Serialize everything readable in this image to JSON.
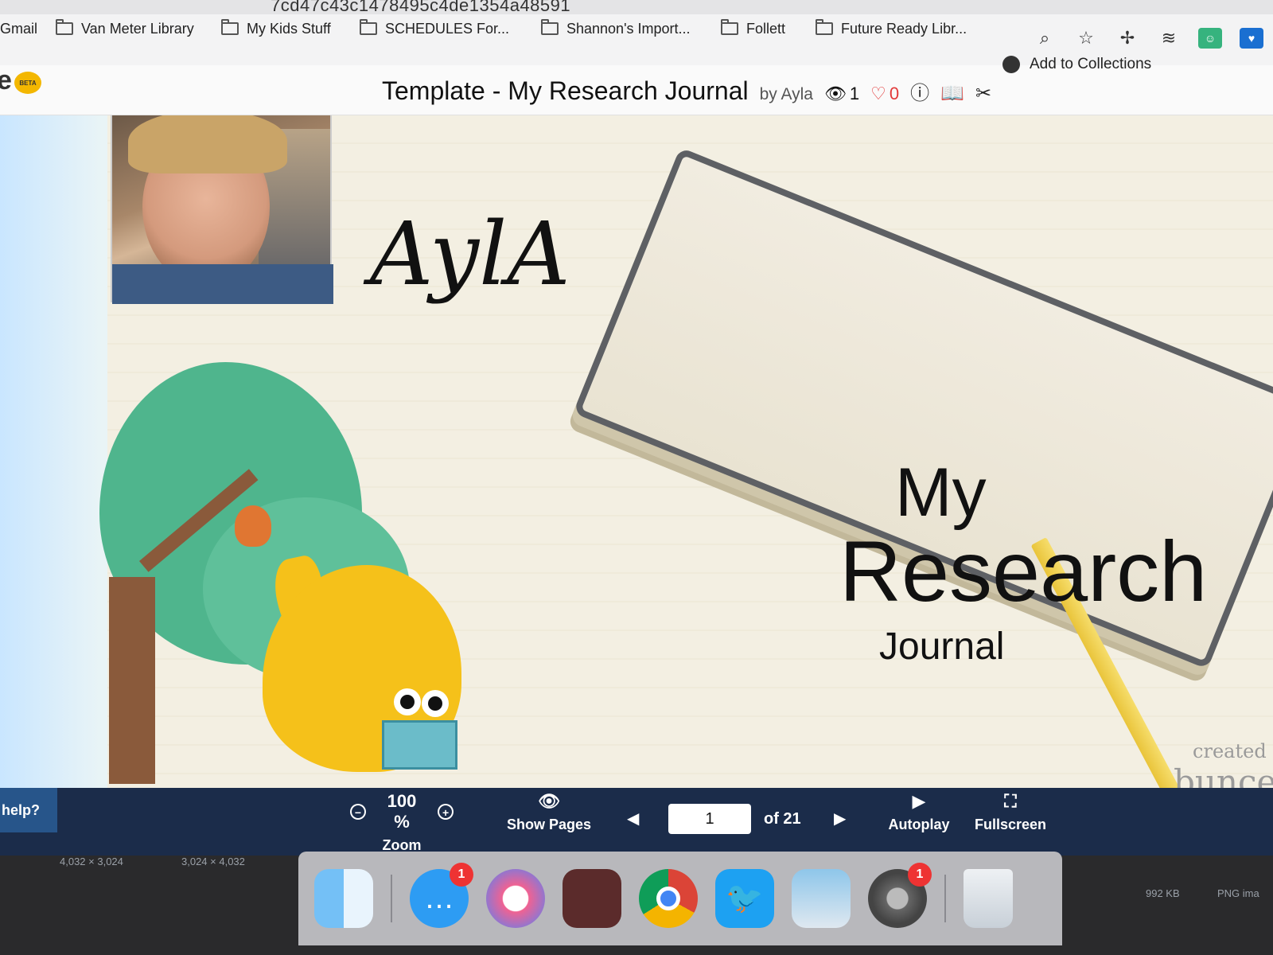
{
  "browser": {
    "url_fragment": "7cd47c43c1478495c4de1354a48591",
    "bookmarks": [
      "Gmail",
      "Van Meter Library",
      "My Kids Stuff",
      "SCHEDULES For...",
      "Shannon's Import...",
      "Follett",
      "Future Ready Libr..."
    ],
    "toolbar_icons": [
      "zoom-icon",
      "star-icon",
      "bird-extension-icon",
      "buffer-extension-icon",
      "green-extension-icon",
      "blue-extension-icon"
    ],
    "add_to_collections": "Add to Collections"
  },
  "app": {
    "logo_letter": "e",
    "beta_label": "BETA",
    "title": "Template - My Research Journal",
    "author": "by Ayla",
    "views": "1",
    "likes": "0"
  },
  "slide": {
    "name_text": "AylA",
    "title_line1": "My",
    "title_line2": "Research",
    "title_line3": "Journal",
    "credit_line1": "created on",
    "credit_line2": "buncee"
  },
  "toolbar": {
    "help": "help?",
    "zoom_value": "100 %",
    "zoom_label": "Zoom",
    "show_pages_label": "Show Pages",
    "current_page": "1",
    "of_pages": "of 21",
    "autoplay_label": "Autoplay",
    "fullscreen_label": "Fullscreen"
  },
  "desktop": {
    "file_dims_1": "4,032 × 3,024",
    "file_dims_2": "3,024 × 4,032",
    "file_size": "992 KB",
    "file_type": "PNG ima",
    "dock_badges": {
      "messages": "1",
      "settings": "1"
    }
  },
  "colors": {
    "toolbar_bg": "#1b2c4a",
    "help_bg": "#27558a",
    "heart": "#e23b3b",
    "beta": "#f3b700"
  }
}
